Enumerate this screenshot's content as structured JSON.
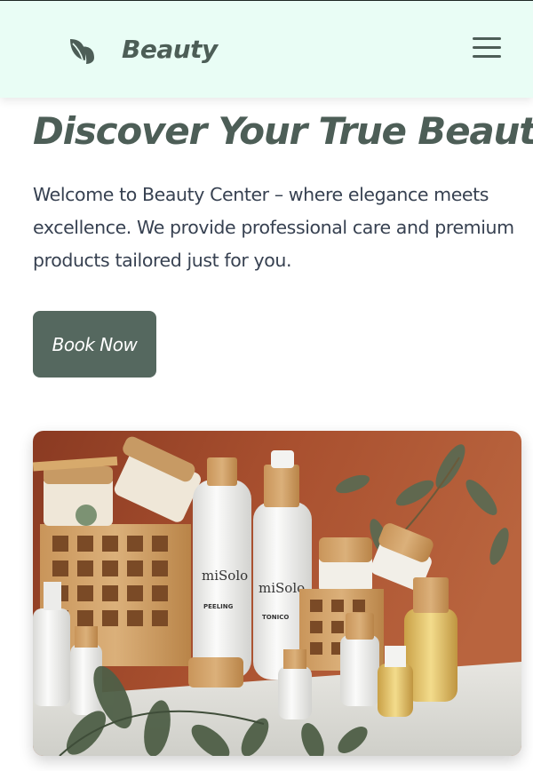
{
  "header": {
    "brand": "Beauty",
    "logo_icon": "leaf-icon",
    "menu_icon": "hamburger-menu-icon"
  },
  "hero": {
    "title": "Discover Your True Beauty",
    "description": "Welcome to Beauty Center – where elegance meets excellence. We provide professional care and premium products tailored just for you.",
    "cta_label": "Book Now",
    "image_labels": {
      "brand": "miSolo",
      "bottle1": "PEELING",
      "bottle2": "TONICO"
    }
  },
  "colors": {
    "header_bg": "#e9fdf5",
    "accent": "#4d5e57",
    "button_bg": "#55685f",
    "text": "#374151"
  }
}
